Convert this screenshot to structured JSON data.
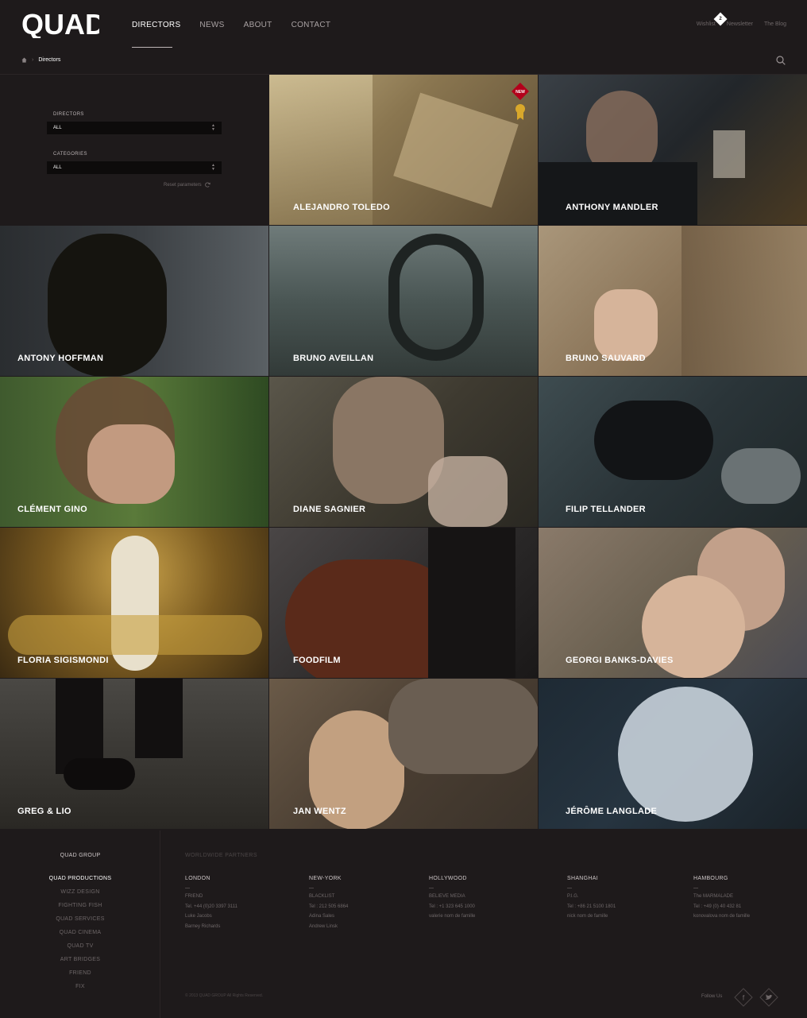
{
  "header": {
    "logo_text": "QUAD",
    "nav": [
      "DIRECTORS",
      "NEWS",
      "ABOUT",
      "CONTACT"
    ],
    "top_links": {
      "wishlist": "Wishlist",
      "wishlist_count": "2",
      "newsletter": "Newsletter",
      "blog": "The Blog"
    }
  },
  "breadcrumb": {
    "current": "Directors"
  },
  "filters": {
    "directors_label": "DIRECTORS",
    "directors_value": "ALL",
    "categories_label": "CATEGORIES",
    "categories_value": "ALL",
    "reset": "Reset parameters"
  },
  "badge": {
    "new": "NEW"
  },
  "directors": [
    "ALEJANDRO TOLEDO",
    "ANTHONY MANDLER",
    "ANTONY HOFFMAN",
    "BRUNO AVEILLAN",
    "BRUNO SAUVARD",
    "CLÉMENT GINO",
    "DIANE SAGNIER",
    "FILIP TELLANDER",
    "FLORIA SIGISMONDI",
    "FOODFILM",
    "GEORGI BANKS-DAVIES",
    "GREG & LIO",
    "JAN WENTZ",
    "JÉRÔME LANGLADE"
  ],
  "footer": {
    "group": "QUAD GROUP",
    "companies": [
      "QUAD PRODUCTIONS",
      "WIZZ DESIGN",
      "FIGHTING FISH",
      "QUAD SERVICES",
      "QUAD CINEMA",
      "QUAD TV",
      "ART BRIDGES",
      "FRIEND",
      "FIX"
    ],
    "partners_title": "WORLDWIDE PARTNERS",
    "cities": [
      {
        "name": "LONDON",
        "lines": [
          "FRIEND",
          "Tel. +44 (0)20 3397 3111",
          "Luke Jacobs",
          "Barney Richards"
        ]
      },
      {
        "name": "NEW-YORK",
        "lines": [
          "BLACKLIST",
          "Tel : 212 505 6864",
          "Adina Sales",
          "Andrew Linsk"
        ]
      },
      {
        "name": "HOLLYWOOD",
        "lines": [
          "BELIEVE MEDIA",
          "Tel : +1 323 645 1000",
          "valerie nom de famille"
        ]
      },
      {
        "name": "SHANGHAI",
        "lines": [
          "P.I.G.",
          "Tel : +86 21 5100 1801",
          "nick nom de famille"
        ]
      },
      {
        "name": "HAMBOURG",
        "lines": [
          "The MARMALADE",
          "Tel : +49 (0) 40 432 81",
          "konovalova nom de famille"
        ]
      }
    ],
    "copyright": "© 2013 QUAD GROUP All Rights Reserved.",
    "follow": "Follow Us"
  }
}
